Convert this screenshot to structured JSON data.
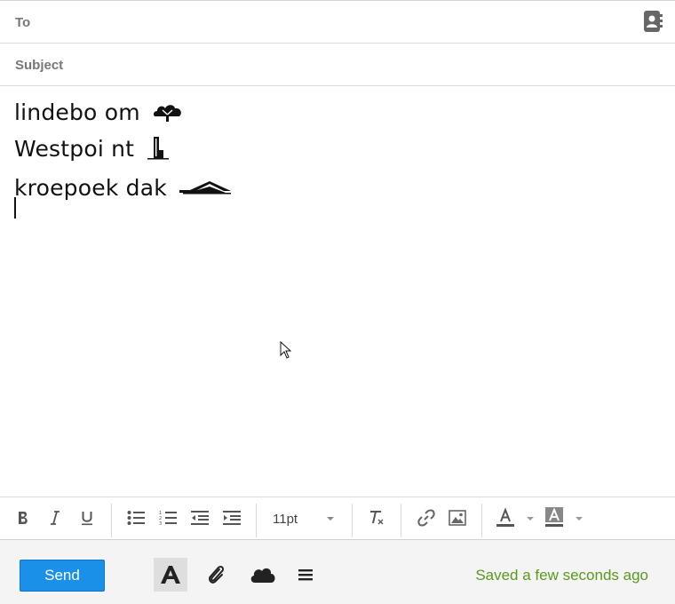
{
  "header": {
    "to_label": "To",
    "to_value": "",
    "subject_label": "Subject",
    "subject_value": ""
  },
  "body": {
    "lines": [
      {
        "text": "lindebo om",
        "icon": "tree-icon"
      },
      {
        "text": "Westpoi nt",
        "icon": "tower-icon"
      },
      {
        "text": "kroepoek dak",
        "icon": "roof-icon"
      }
    ]
  },
  "toolbar": {
    "font_size": "11pt",
    "buttons": [
      "bold-icon",
      "italic-icon",
      "underline-icon",
      "bullet-list-icon",
      "numbered-list-icon",
      "outdent-icon",
      "indent-icon",
      "clear-format-icon",
      "link-icon",
      "image-icon",
      "text-color-icon",
      "highlight-color-icon"
    ]
  },
  "footer": {
    "send_label": "Send",
    "status": "Saved a few seconds ago",
    "icons": [
      "text-format-icon",
      "attachment-icon",
      "cloud-icon",
      "more-menu-icon"
    ]
  },
  "colors": {
    "accent": "#1a90e8",
    "saved_text": "#5a9a1e",
    "footer_bg": "#f4f4f4"
  }
}
